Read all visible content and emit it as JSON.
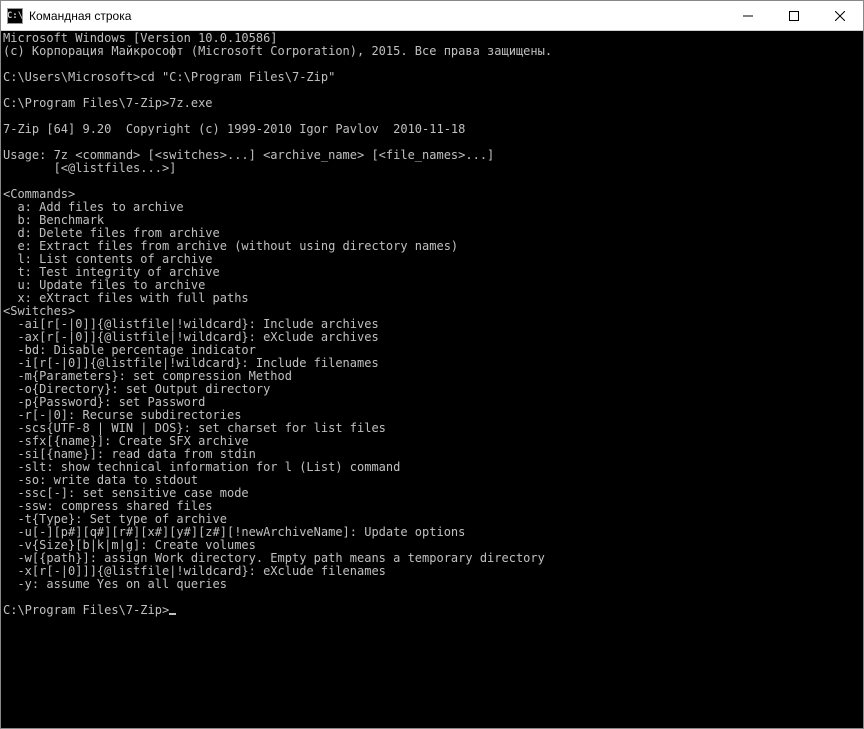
{
  "titlebar": {
    "icon_text": "C:\\",
    "title": "Командная строка"
  },
  "terminal": {
    "lines": [
      "Microsoft Windows [Version 10.0.10586]",
      "(с) Корпорация Майкрософт (Microsoft Corporation), 2015. Все права защищены.",
      "",
      "C:\\Users\\Microsoft>cd \"C:\\Program Files\\7-Zip\"",
      "",
      "C:\\Program Files\\7-Zip>7z.exe",
      "",
      "7-Zip [64] 9.20  Copyright (c) 1999-2010 Igor Pavlov  2010-11-18",
      "",
      "Usage: 7z <command> [<switches>...] <archive_name> [<file_names>...]",
      "       [<@listfiles...>]",
      "",
      "<Commands>",
      "  a: Add files to archive",
      "  b: Benchmark",
      "  d: Delete files from archive",
      "  e: Extract files from archive (without using directory names)",
      "  l: List contents of archive",
      "  t: Test integrity of archive",
      "  u: Update files to archive",
      "  x: eXtract files with full paths",
      "<Switches>",
      "  -ai[r[-|0]]{@listfile|!wildcard}: Include archives",
      "  -ax[r[-|0]]{@listfile|!wildcard}: eXclude archives",
      "  -bd: Disable percentage indicator",
      "  -i[r[-|0]]{@listfile|!wildcard}: Include filenames",
      "  -m{Parameters}: set compression Method",
      "  -o{Directory}: set Output directory",
      "  -p{Password}: set Password",
      "  -r[-|0]: Recurse subdirectories",
      "  -scs{UTF-8 | WIN | DOS}: set charset for list files",
      "  -sfx[{name}]: Create SFX archive",
      "  -si[{name}]: read data from stdin",
      "  -slt: show technical information for l (List) command",
      "  -so: write data to stdout",
      "  -ssc[-]: set sensitive case mode",
      "  -ssw: compress shared files",
      "  -t{Type}: Set type of archive",
      "  -u[-][p#][q#][r#][x#][y#][z#][!newArchiveName]: Update options",
      "  -v{Size}[b|k|m|g]: Create volumes",
      "  -w[{path}]: assign Work directory. Empty path means a temporary directory",
      "  -x[r[-|0]]]{@listfile|!wildcard}: eXclude filenames",
      "  -y: assume Yes on all queries",
      "",
      "C:\\Program Files\\7-Zip>"
    ]
  }
}
